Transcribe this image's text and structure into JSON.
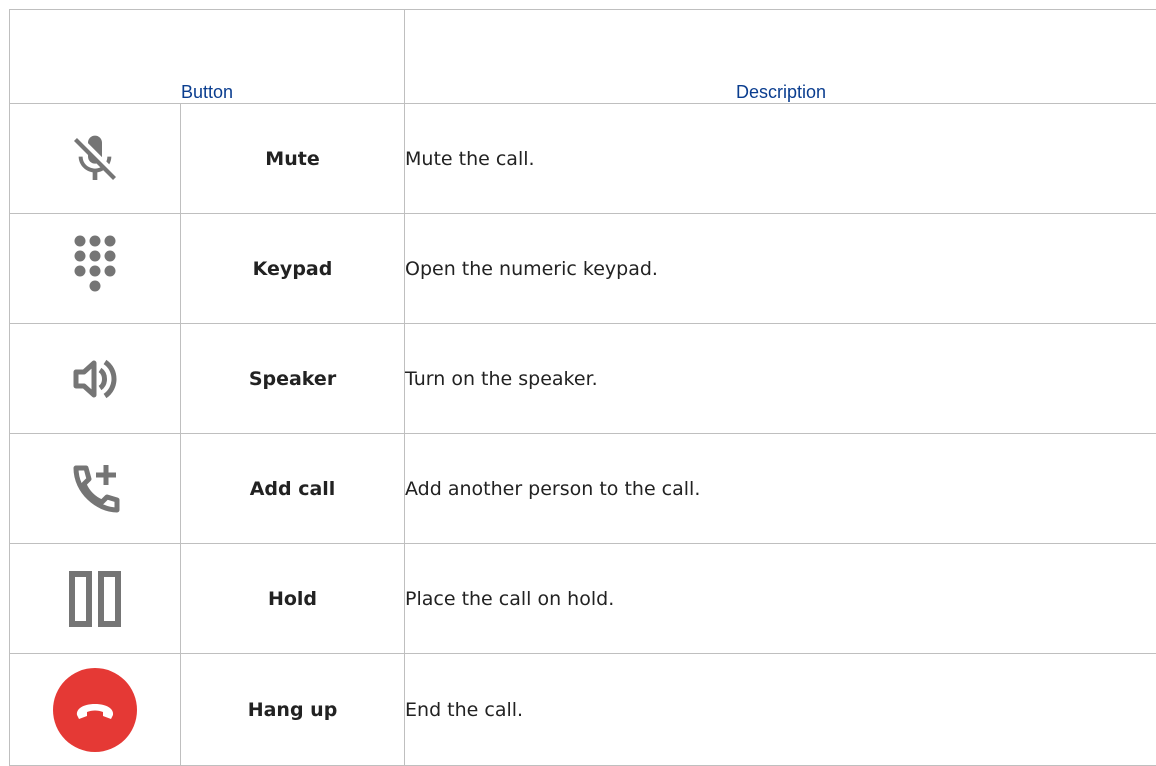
{
  "table": {
    "header": {
      "button": "Button",
      "description": "Description"
    },
    "rows": [
      {
        "icon": "mic-off-icon",
        "label": "Mute",
        "description": "Mute the call."
      },
      {
        "icon": "dialpad-icon",
        "label": "Keypad",
        "description": "Open the numeric keypad."
      },
      {
        "icon": "speaker-icon",
        "label": "Speaker",
        "description": "Turn on the speaker."
      },
      {
        "icon": "add-call-icon",
        "label": "Add call",
        "description": "Add another person to the call."
      },
      {
        "icon": "pause-icon",
        "label": "Hold",
        "description": "Place the call on hold."
      },
      {
        "icon": "hang-up-icon",
        "label": "Hang up",
        "description": "End the call."
      }
    ]
  },
  "colors": {
    "header_text": "#0a3d8f",
    "icon_gray": "#757575",
    "hang_up_red": "#e53935",
    "border": "#bfbfbf"
  }
}
